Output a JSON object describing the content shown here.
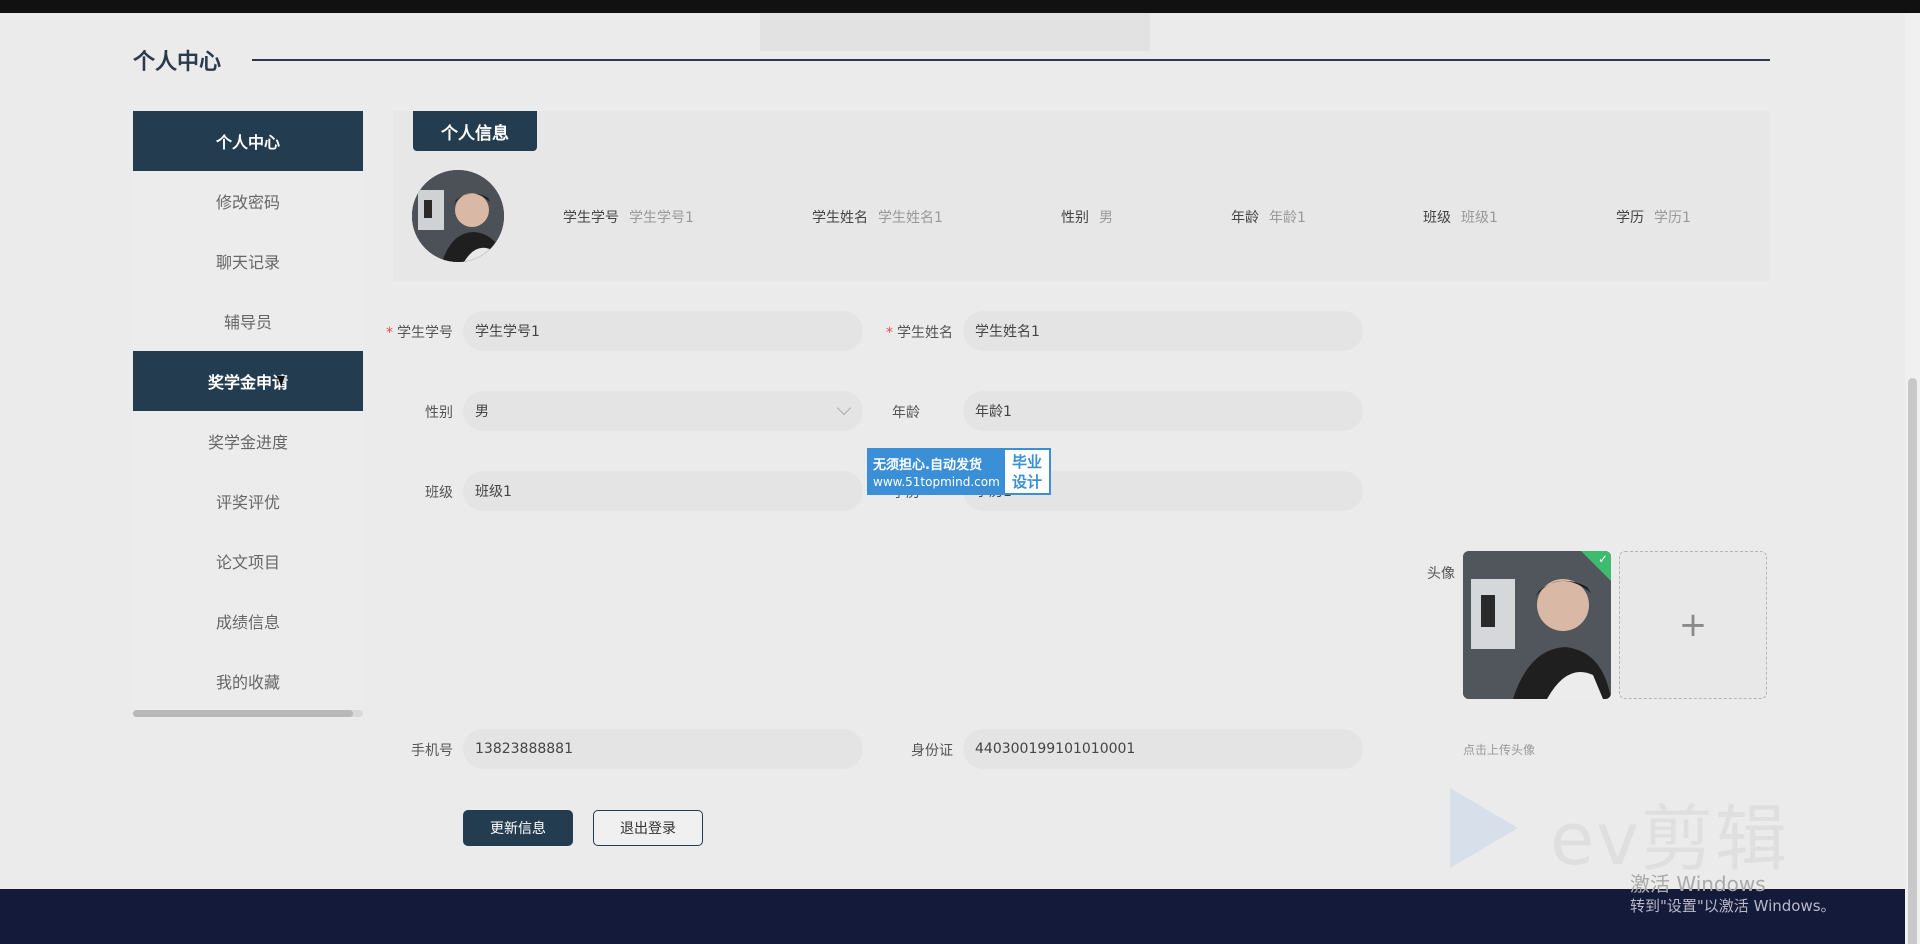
{
  "page": {
    "title": "个人中心"
  },
  "sidebar": {
    "items": [
      {
        "label": "个人中心",
        "active": true
      },
      {
        "label": "修改密码",
        "active": false
      },
      {
        "label": "聊天记录",
        "active": false
      },
      {
        "label": "辅导员",
        "active": false
      },
      {
        "label": "奖学金申请",
        "active": true
      },
      {
        "label": "奖学金进度",
        "active": false
      },
      {
        "label": "评奖评优",
        "active": false
      },
      {
        "label": "论文项目",
        "active": false
      },
      {
        "label": "成绩信息",
        "active": false
      },
      {
        "label": "我的收藏",
        "active": false
      }
    ]
  },
  "info_panel": {
    "tab_label": "个人信息",
    "items": [
      {
        "key": "学生学号",
        "value": "学生学号1"
      },
      {
        "key": "学生姓名",
        "value": "学生姓名1"
      },
      {
        "key": "性别",
        "value": "男"
      },
      {
        "key": "年龄",
        "value": "年龄1"
      },
      {
        "key": "班级",
        "value": "班级1"
      },
      {
        "key": "学历",
        "value": "学历1"
      }
    ]
  },
  "form": {
    "student_id": {
      "label": "学生学号",
      "value": "学生学号1",
      "required": true
    },
    "student_name": {
      "label": "学生姓名",
      "value": "学生姓名1",
      "required": true
    },
    "gender": {
      "label": "性别",
      "value": "男"
    },
    "age": {
      "label": "年龄",
      "value": "年龄1"
    },
    "class": {
      "label": "班级",
      "value": "班级1"
    },
    "education": {
      "label": "学历",
      "value": "学历1"
    },
    "avatar": {
      "label": "头像",
      "hint": "点击上传头像",
      "add_symbol": "+"
    },
    "phone": {
      "label": "手机号",
      "value": "13823888881"
    },
    "id_card": {
      "label": "身份证",
      "value": "440300199101010001"
    },
    "required_mark": "*"
  },
  "buttons": {
    "update": "更新信息",
    "logout": "退出登录"
  },
  "watermark": {
    "line1": "无须担心.自动发货",
    "line2": "www.51topmind.com",
    "side_top": "毕业",
    "side_bottom": "设计"
  },
  "overlay": {
    "ev_text": "ev剪辑",
    "activate_title": "激活 Windows",
    "activate_sub": "转到\"设置\"以激活 Windows。"
  },
  "colors": {
    "primary": "#243c4f",
    "footer": "#131a3a",
    "required": "#e84b4b",
    "success": "#3dbb6e"
  }
}
